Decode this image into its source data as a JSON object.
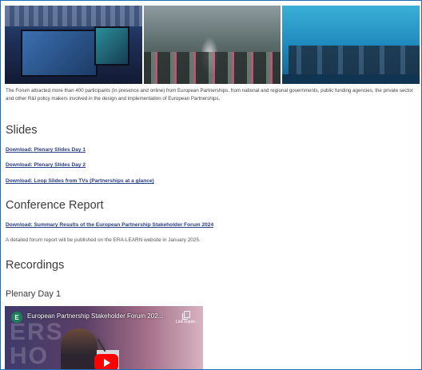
{
  "intro_text": "The Forum attracted more than 400 participants (in presence and online) from European Partnerships, from national and regional governments, public funding agencies, the private sector and other R&I policy makers involved in the design and implementation of European Partnerships.",
  "slides": {
    "heading": "Slides",
    "links": [
      "Download: Plenary Slides Day 1",
      "Download: Plenary Slides Day 2",
      "Download: Loop Slides from TVs (Partnerships at a glance)"
    ]
  },
  "report": {
    "heading": "Conference Report",
    "link": "Download: Summary Results of the European Partnership Stakeholder Forum 2024",
    "note": "A detailed forum report will be published on the ERA-LEARN website in January 2025."
  },
  "recordings": {
    "heading": "Recordings",
    "subheading": "Plenary Day 1",
    "video": {
      "channel_initial": "E",
      "title": "European Partnership Stakeholder Forum 202...",
      "copy_label": "Link kopier...",
      "background_text": "ERS\nHO"
    }
  }
}
